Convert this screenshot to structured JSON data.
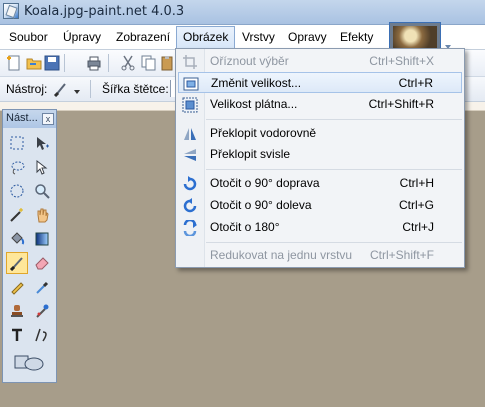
{
  "window": {
    "title": "Koala.jpg-paint.net 4.0.3"
  },
  "menubar": {
    "items": [
      {
        "label": "Soubor"
      },
      {
        "label": "Úpravy"
      },
      {
        "label": "Zobrazení"
      },
      {
        "label": "Obrázek",
        "active": true
      },
      {
        "label": "Vrstvy"
      },
      {
        "label": "Opravy"
      },
      {
        "label": "Efekty"
      }
    ]
  },
  "toolbar": {
    "tool_label": "Nástroj:",
    "brush_width_label": "Šířka štětce:"
  },
  "tools_window": {
    "title": "Nást...",
    "close_glyph": "x",
    "tools": [
      "rectangle-select-icon",
      "move-selection-icon",
      "lasso-select-icon",
      "move-selected-icon",
      "ellipse-select-icon",
      "zoom-icon",
      "magic-wand-icon",
      "pan-hand-icon",
      "paint-bucket-icon",
      "gradient-icon",
      "paintbrush-icon",
      "eraser-icon",
      "pencil-icon",
      "color-picker-icon",
      "clone-stamp-icon",
      "recolor-icon",
      "text-icon",
      "line-curve-icon",
      "shapes-icon"
    ],
    "selected_tool": "paintbrush-icon"
  },
  "image_menu": {
    "items": [
      {
        "label": "Oříznout výběr",
        "shortcut": "Ctrl+Shift+X",
        "icon": "crop-icon",
        "disabled": true
      },
      {
        "label": "Změnit velikost...",
        "shortcut": "Ctrl+R",
        "icon": "resize-icon",
        "hover": true
      },
      {
        "label": "Velikost plátna...",
        "shortcut": "Ctrl+Shift+R",
        "icon": "canvas-size-icon"
      },
      {
        "label": "Překlopit vodorovně",
        "shortcut": "",
        "icon": "flip-horizontal-icon"
      },
      {
        "label": "Překlopit svisle",
        "shortcut": "",
        "icon": "flip-vertical-icon"
      },
      {
        "label": "Otočit o 90° doprava",
        "shortcut": "Ctrl+H",
        "icon": "rotate-right-icon"
      },
      {
        "label": "Otočit o 90° doleva",
        "shortcut": "Ctrl+G",
        "icon": "rotate-left-icon"
      },
      {
        "label": "Otočit o 180°",
        "shortcut": "Ctrl+J",
        "icon": "rotate-180-icon"
      },
      {
        "label": "Redukovat na jednu vrstvu",
        "shortcut": "Ctrl+Shift+F",
        "icon": "flatten-icon",
        "disabled": true
      }
    ]
  },
  "colors": {
    "accent": "#3b78c8",
    "menu_hover": "#dde9f8",
    "disabled_text": "#8e96a1"
  }
}
